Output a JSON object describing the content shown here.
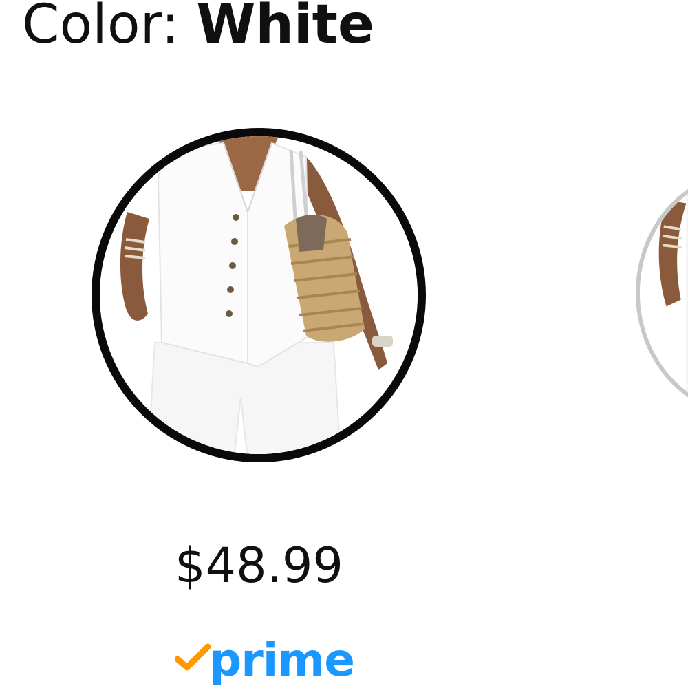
{
  "variation": {
    "label": "Color: ",
    "selected_value": "White"
  },
  "swatches": [
    {
      "name": "White",
      "selected": true,
      "icon": "outfit-white-vest-image"
    },
    {
      "name": "",
      "selected": false,
      "icon": "outfit-partial-image"
    }
  ],
  "selected_option": {
    "price": "$48.99",
    "badge": "prime"
  },
  "colors": {
    "text": "#0f1111",
    "selected_border": "#0a0a0a",
    "unselected_border": "#c8c8c8",
    "prime_blue": "#1a98ff",
    "prime_check": "#ff9900"
  }
}
